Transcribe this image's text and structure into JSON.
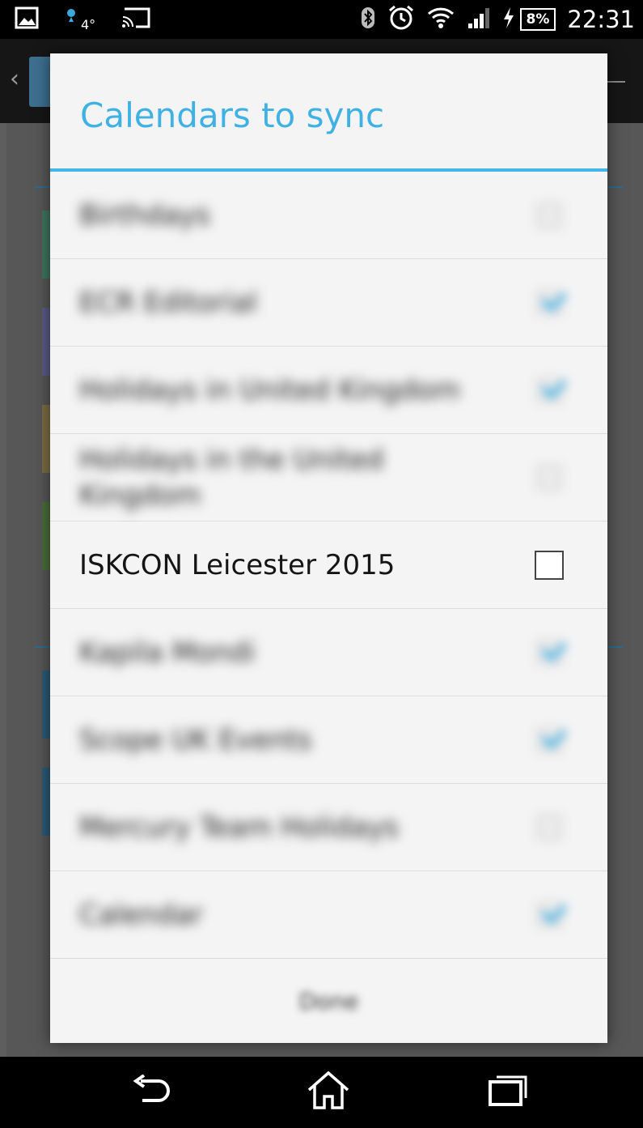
{
  "status_bar": {
    "icons": [
      "image-icon",
      "weather-icon",
      "cast-icon",
      "bluetooth-icon",
      "alarm-icon",
      "wifi-icon",
      "signal-icon",
      "charging-icon"
    ],
    "temperature": "4°",
    "battery_percent": "8%",
    "time": "22:31"
  },
  "dialog": {
    "title": "Calendars to sync",
    "items": [
      {
        "label": "Birthdays",
        "checked": false,
        "obscured": true
      },
      {
        "label": "ECR Editorial",
        "checked": true,
        "obscured": true
      },
      {
        "label": "Holidays in United Kingdom",
        "checked": true,
        "obscured": true
      },
      {
        "label": "Holidays in the United Kingdom",
        "checked": false,
        "obscured": true
      },
      {
        "label": "ISKCON Leicester 2015",
        "checked": false,
        "obscured": false
      },
      {
        "label": "Kapila Mondi",
        "checked": true,
        "obscured": true
      },
      {
        "label": "Scope UK Events",
        "checked": true,
        "obscured": true
      },
      {
        "label": "Mercury Team Holidays",
        "checked": false,
        "obscured": true
      },
      {
        "label": "Calendar",
        "checked": true,
        "obscured": true
      }
    ],
    "done_label": "Done"
  },
  "colors": {
    "accent": "#3fb2e3",
    "check": "#3aa9de",
    "dialog_bg": "#f4f4f4"
  },
  "nav_bar": {
    "icons": [
      "back-icon",
      "home-icon",
      "recents-icon"
    ]
  }
}
